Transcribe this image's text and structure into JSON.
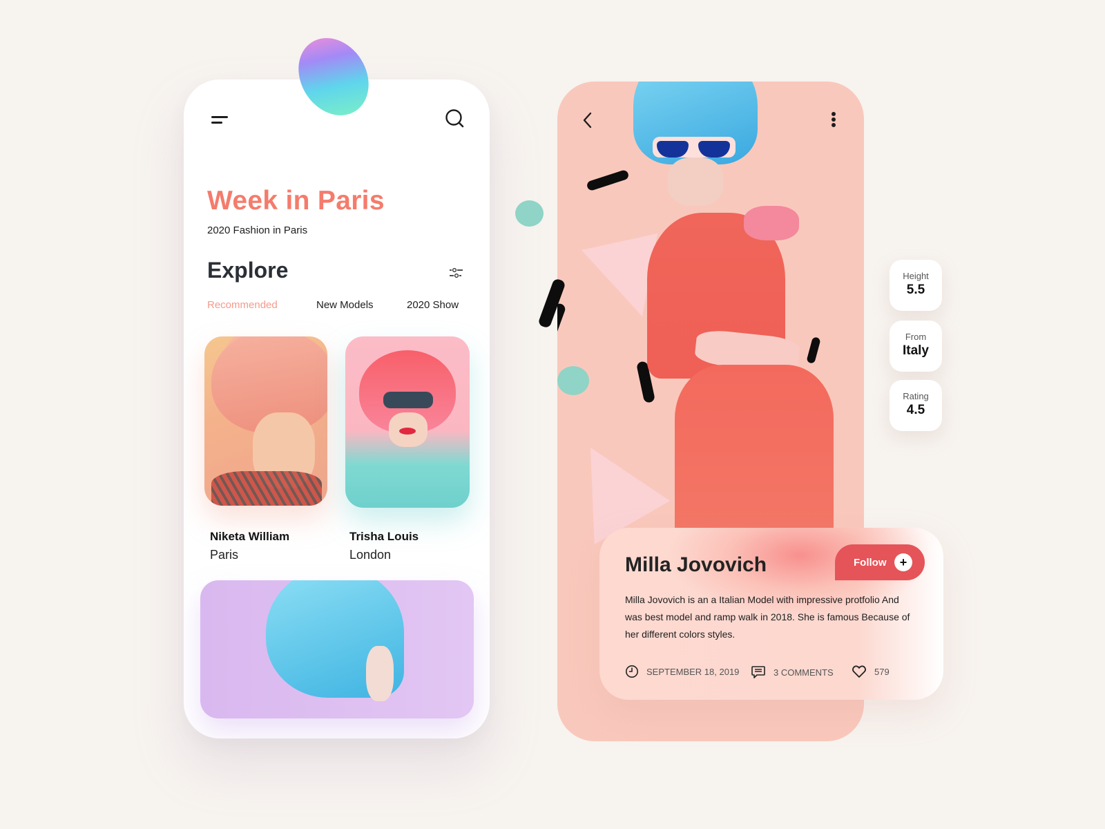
{
  "left_screen": {
    "header": {
      "menu_icon": "menu-icon",
      "search_icon": "search-icon"
    },
    "title": "Week in Paris",
    "subtitle": "2020 Fashion in Paris",
    "section_title": "Explore",
    "filter_icon": "sliders-icon",
    "tabs": [
      {
        "label": "Recommended",
        "active": true
      },
      {
        "label": "New Models",
        "active": false
      },
      {
        "label": "2020 Show",
        "active": false
      }
    ],
    "models": [
      {
        "name": "Niketa William",
        "city": "Paris"
      },
      {
        "name": "Trisha Louis",
        "city": "London"
      }
    ]
  },
  "right_screen": {
    "header": {
      "back_icon": "chevron-left-icon",
      "more_icon": "more-vertical-icon"
    },
    "stats": [
      {
        "label": "Height",
        "value": "5.5"
      },
      {
        "label": "From",
        "value": "Italy"
      },
      {
        "label": "Rating",
        "value": "4.5"
      }
    ],
    "profile": {
      "name": "Milla Jovovich",
      "follow_label": "Follow",
      "follow_icon": "+",
      "description": "Milla Jovovich is an a Italian Model with impressive protfolio And was best model and ramp walk in 2018. She is famous Because of her different colors styles.",
      "date": "SEPTEMBER 18, 2019",
      "comments": "3 COMMENTS",
      "likes": "579"
    }
  },
  "colors": {
    "accent": "#f47c6c",
    "follow_button": "#e55458",
    "background": "#f7f3ef",
    "right_phone": "#f9c8bc",
    "teal_dot": "#8fd4c6"
  }
}
